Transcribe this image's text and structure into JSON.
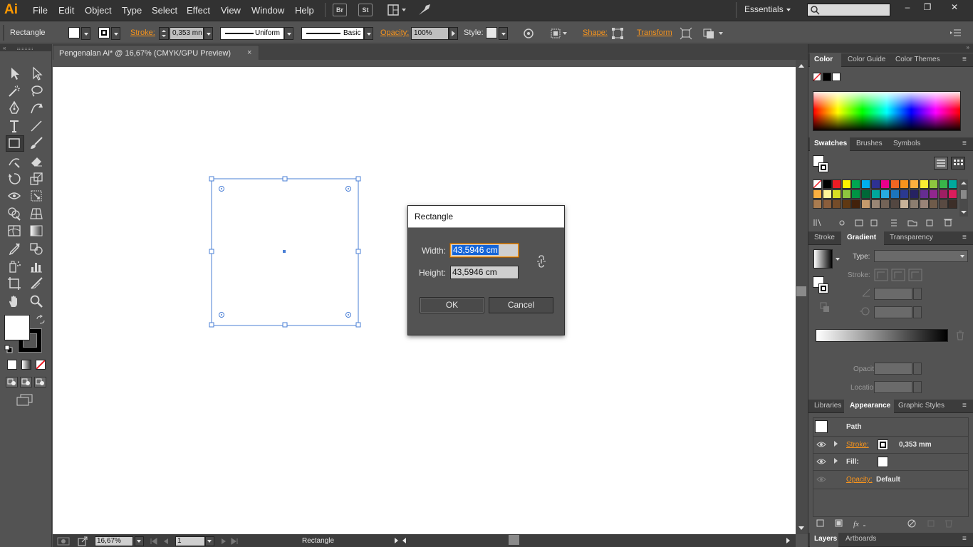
{
  "app": {
    "logo": "Ai",
    "menu": [
      "File",
      "Edit",
      "Object",
      "Type",
      "Select",
      "Effect",
      "View",
      "Window",
      "Help"
    ],
    "bridge_label": "Br",
    "stock_label": "St",
    "workspace": "Essentials",
    "window_controls": [
      "–",
      "❐",
      "✕"
    ]
  },
  "control_bar": {
    "tool_name": "Rectangle",
    "stroke_label": "Stroke:",
    "stroke_weight": "0,353 mn",
    "profile": "Uniform",
    "brush": "Basic",
    "opacity_label": "Opacity:",
    "opacity": "100%",
    "style_label": "Style:",
    "shape_label": "Shape:",
    "transform_label": "Transform"
  },
  "document": {
    "tab_title": "Pengenalan Ai* @ 16,67% (CMYK/GPU Preview)",
    "close": "×"
  },
  "status": {
    "zoom": "16,67%",
    "page": "1",
    "tool": "Rectangle"
  },
  "dialog": {
    "title": "Rectangle",
    "width_label": "Width:",
    "width_value": "43,5946 cm",
    "height_label": "Height:",
    "height_value": "43,5946 cm",
    "ok_label": "OK",
    "cancel_label": "Cancel"
  },
  "panels": {
    "color_tabs": [
      "Color",
      "Color Guide",
      "Color Themes"
    ],
    "swatch_tabs": [
      "Swatches",
      "Brushes",
      "Symbols"
    ],
    "gradient_tabs": [
      "Stroke",
      "Gradient",
      "Transparency"
    ],
    "gradient": {
      "type_label": "Type:",
      "stroke_label": "Stroke:",
      "opacity_label": "Opacity:",
      "location_label": "Location:"
    },
    "appearance_tabs": [
      "Libraries",
      "Appearance",
      "Graphic Styles"
    ],
    "appearance": {
      "path_label": "Path",
      "stroke_label": "Stroke:",
      "stroke_value": "0,353 mm",
      "fill_label": "Fill:",
      "opacity_label": "Opacity:",
      "opacity_value": "Default"
    },
    "layers_tabs": [
      "Layers",
      "Artboards"
    ]
  },
  "colors": {
    "accent_orange": "#f7941d",
    "selection_blue": "#4a7fd6",
    "dialog_highlight": "#1565d8"
  },
  "swatch_colors": [
    [
      "#ffffff",
      "#000000",
      "#ed1c24",
      "#fff200",
      "#00a651",
      "#00aeef",
      "#2e3192",
      "#ec008c",
      "#f26522",
      "#f7941d",
      "#fbaf3f",
      "#f9ed32",
      "#8dc63f",
      "#39b54a",
      "#00a99d"
    ],
    [
      "#fbb040",
      "#fff799",
      "#d7df23",
      "#8dc63f",
      "#009444",
      "#006838",
      "#00a79d",
      "#27aae1",
      "#1c75bc",
      "#2b3990",
      "#262262",
      "#662d91",
      "#92278f",
      "#9e1f63",
      "#da1c5c"
    ],
    [
      "#a97c50",
      "#8b5e3c",
      "#754c29",
      "#603913",
      "#42210b",
      "#c49a6c",
      "#998675",
      "#736357",
      "#534741",
      "#c7b299",
      "#8c7e70",
      "#9a8478",
      "#6f5b4a",
      "#594a42",
      "#3c2e28"
    ]
  ]
}
